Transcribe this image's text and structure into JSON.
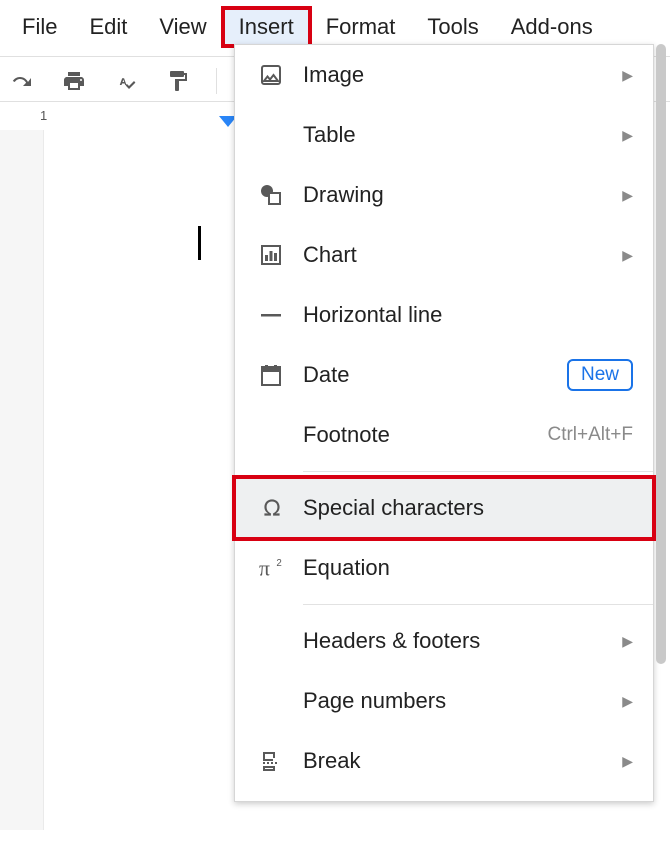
{
  "menubar": {
    "items": [
      {
        "label": "File"
      },
      {
        "label": "Edit"
      },
      {
        "label": "View"
      },
      {
        "label": "Insert",
        "active": true
      },
      {
        "label": "Format"
      },
      {
        "label": "Tools"
      },
      {
        "label": "Add-ons"
      }
    ]
  },
  "ruler": {
    "num1": "1"
  },
  "dropdown": {
    "items": [
      {
        "icon": "image-icon",
        "label": "Image",
        "submenu": true
      },
      {
        "icon": "",
        "label": "Table",
        "submenu": true
      },
      {
        "icon": "drawing-icon",
        "label": "Drawing",
        "submenu": true
      },
      {
        "icon": "chart-icon",
        "label": "Chart",
        "submenu": true
      },
      {
        "icon": "hline-icon",
        "label": "Horizontal line"
      },
      {
        "icon": "date-icon",
        "label": "Date",
        "badge": "New"
      },
      {
        "icon": "",
        "label": "Footnote",
        "shortcut": "Ctrl+Alt+F"
      }
    ],
    "section2": [
      {
        "icon": "omega-icon",
        "label": "Special characters",
        "highlight": true
      },
      {
        "icon": "equation-icon",
        "label": "Equation"
      }
    ],
    "section3": [
      {
        "icon": "",
        "label": "Headers & footers",
        "submenu": true
      },
      {
        "icon": "",
        "label": "Page numbers",
        "submenu": true
      },
      {
        "icon": "break-icon",
        "label": "Break",
        "submenu": true
      }
    ]
  }
}
